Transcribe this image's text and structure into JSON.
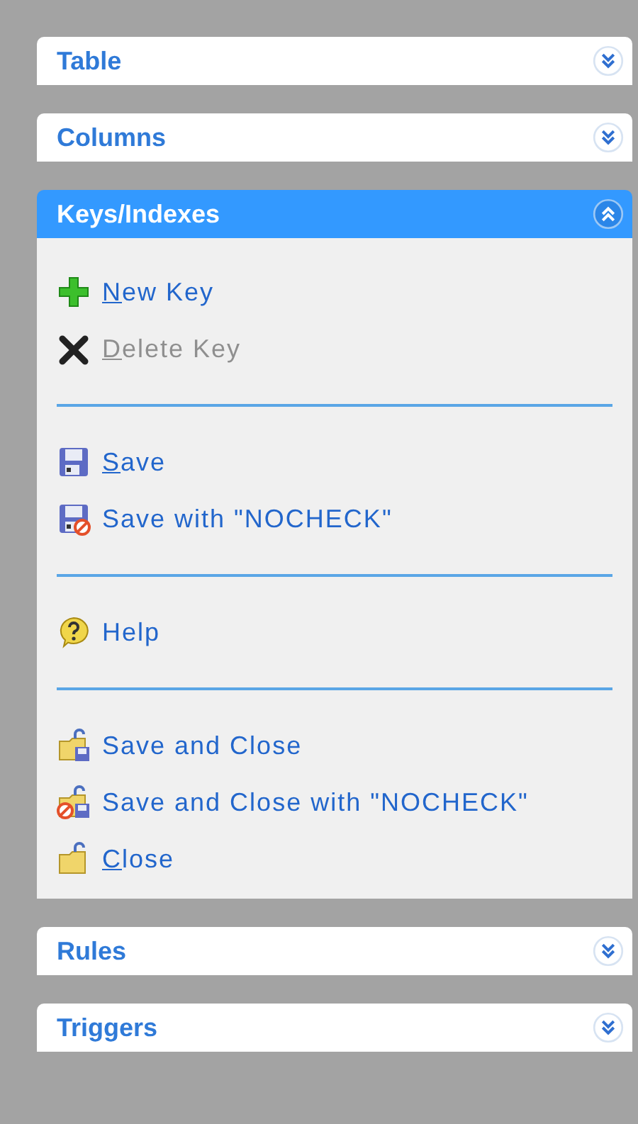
{
  "panels": [
    {
      "title": "Table",
      "expanded": false
    },
    {
      "title": "Columns",
      "expanded": false
    },
    {
      "title": "Keys/Indexes",
      "expanded": true,
      "items": [
        {
          "kind": "action",
          "label": "New Key",
          "underline_first": true,
          "disabled": false
        },
        {
          "kind": "action",
          "label": "Delete Key",
          "underline_first": true,
          "disabled": true
        },
        {
          "kind": "separator"
        },
        {
          "kind": "action",
          "label": "Save",
          "underline_first": true,
          "disabled": false
        },
        {
          "kind": "action",
          "label": "Save with \"NOCHECK\"",
          "underline_first": false,
          "disabled": false
        },
        {
          "kind": "separator"
        },
        {
          "kind": "action",
          "label": "Help",
          "underline_first": false,
          "disabled": false
        },
        {
          "kind": "separator"
        },
        {
          "kind": "action",
          "label": "Save and Close",
          "underline_first": false,
          "disabled": false
        },
        {
          "kind": "action",
          "label": "Save and Close with \"NOCHECK\"",
          "underline_first": false,
          "disabled": false
        },
        {
          "kind": "action",
          "label": "Close",
          "underline_first": true,
          "disabled": false
        }
      ]
    },
    {
      "title": "Rules",
      "expanded": false
    },
    {
      "title": "Triggers",
      "expanded": false
    }
  ]
}
